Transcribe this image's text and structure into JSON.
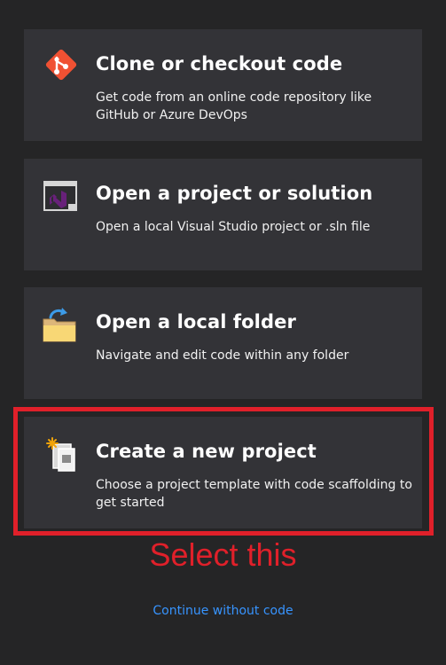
{
  "cards": [
    {
      "title": "Clone or checkout code",
      "description": "Get code from an online code repository like GitHub or Azure DevOps",
      "icon": "git-clone-icon"
    },
    {
      "title": "Open a project or solution",
      "description": "Open a local Visual Studio project or .sln file",
      "icon": "visual-studio-solution-icon"
    },
    {
      "title": "Open a local folder",
      "description": "Navigate and edit code within any folder",
      "icon": "open-folder-icon"
    },
    {
      "title": "Create a new project",
      "description": "Choose a project template with code scaffolding to get started",
      "icon": "new-project-icon"
    }
  ],
  "annotation": {
    "text": "Select this",
    "color": "#e0202a"
  },
  "continue_link": "Continue without code",
  "colors": {
    "background": "#252526",
    "card": "#333337",
    "link": "#3794ff",
    "git_orange": "#f05133",
    "vs_purple": "#68217a"
  }
}
